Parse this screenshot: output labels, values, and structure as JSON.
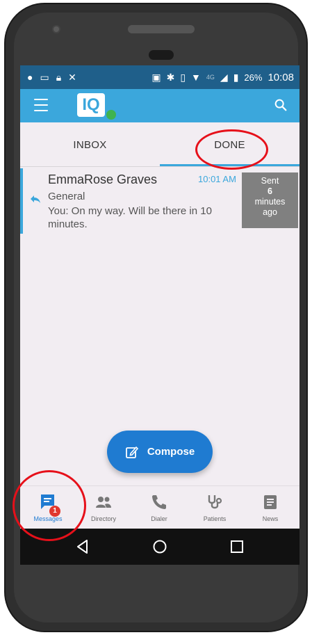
{
  "status_bar": {
    "battery": "26%",
    "time": "10:08",
    "network": "4G"
  },
  "app_bar": {
    "logo_text": "IQ"
  },
  "tabs": [
    {
      "label": "INBOX"
    },
    {
      "label": "DONE"
    }
  ],
  "messages": [
    {
      "sender": "EmmaRose Graves",
      "time": "10:01 AM",
      "group": "General",
      "preview": "You: On my way. Will be there in 10 minutes.",
      "sent_label": "Sent",
      "sent_number": "6",
      "sent_unit": "minutes",
      "sent_suffix": "ago"
    }
  ],
  "compose_label": "Compose",
  "bottom_nav": [
    {
      "label": "Messages",
      "icon": "messages-icon",
      "badge": "1"
    },
    {
      "label": "Directory",
      "icon": "directory-icon"
    },
    {
      "label": "Dialer",
      "icon": "phone-icon"
    },
    {
      "label": "Patients",
      "icon": "stethoscope-icon"
    },
    {
      "label": "News",
      "icon": "news-icon"
    }
  ],
  "colors": {
    "accent": "#3ba7dc",
    "primary_button": "#1f7bd1",
    "status_bar": "#1f5f8a",
    "annotation": "#e6101a"
  }
}
